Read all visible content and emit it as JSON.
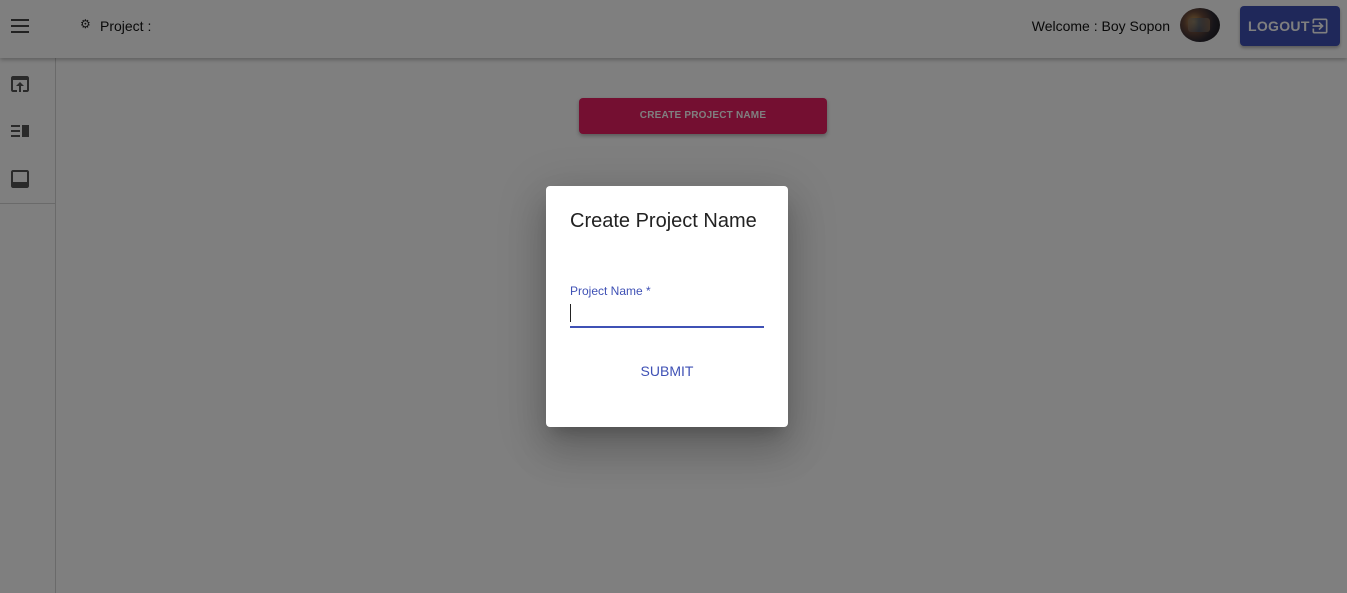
{
  "header": {
    "project_label": "Project :",
    "welcome_text": "Welcome : Boy Sopon",
    "logout_label": "LOGOUT"
  },
  "sidebar": {
    "items": [
      {
        "icon": "open-in-browser-icon"
      },
      {
        "icon": "view-list-icon"
      },
      {
        "icon": "web-asset-icon"
      }
    ]
  },
  "main": {
    "create_button_label": "CREATE PROJECT NAME"
  },
  "dialog": {
    "title": "Create Project Name",
    "field_label": "Project Name *",
    "field_value": "",
    "submit_label": "SUBMIT"
  },
  "colors": {
    "primary": "#3f51b5",
    "secondary": "#e91e63",
    "backdrop": "rgba(0,0,0,0.5)"
  }
}
